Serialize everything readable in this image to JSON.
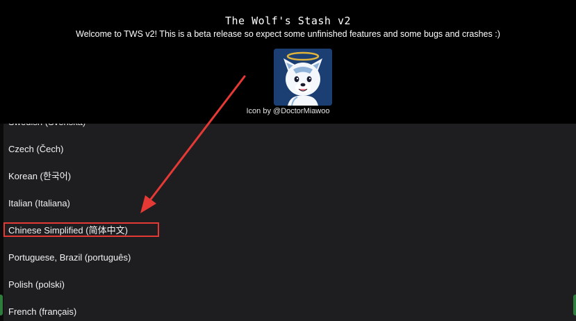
{
  "header": {
    "title": "The Wolf's Stash v2",
    "welcome": "Welcome to TWS v2! This is a beta release so expect some unfinished features and some bugs and crashes :)",
    "icon_credit": "Icon by @DoctorMiawoo"
  },
  "language_list": {
    "items": [
      "Swedish (Svenska)",
      "Czech (Čech)",
      "Korean (한국어)",
      "Italian (Italiana)",
      "Chinese Simplified (简体中文)",
      "Portuguese, Brazil (português)",
      "Polish (polski)",
      "French (français)"
    ],
    "highlighted_item": "Chinese Simplified (简体中文)"
  },
  "annotation": {
    "color": "#e53935"
  },
  "colors": {
    "background": "#000000",
    "list_background": "#1e1e21",
    "logo_background": "#1c3f73",
    "text": "#ffffff"
  }
}
